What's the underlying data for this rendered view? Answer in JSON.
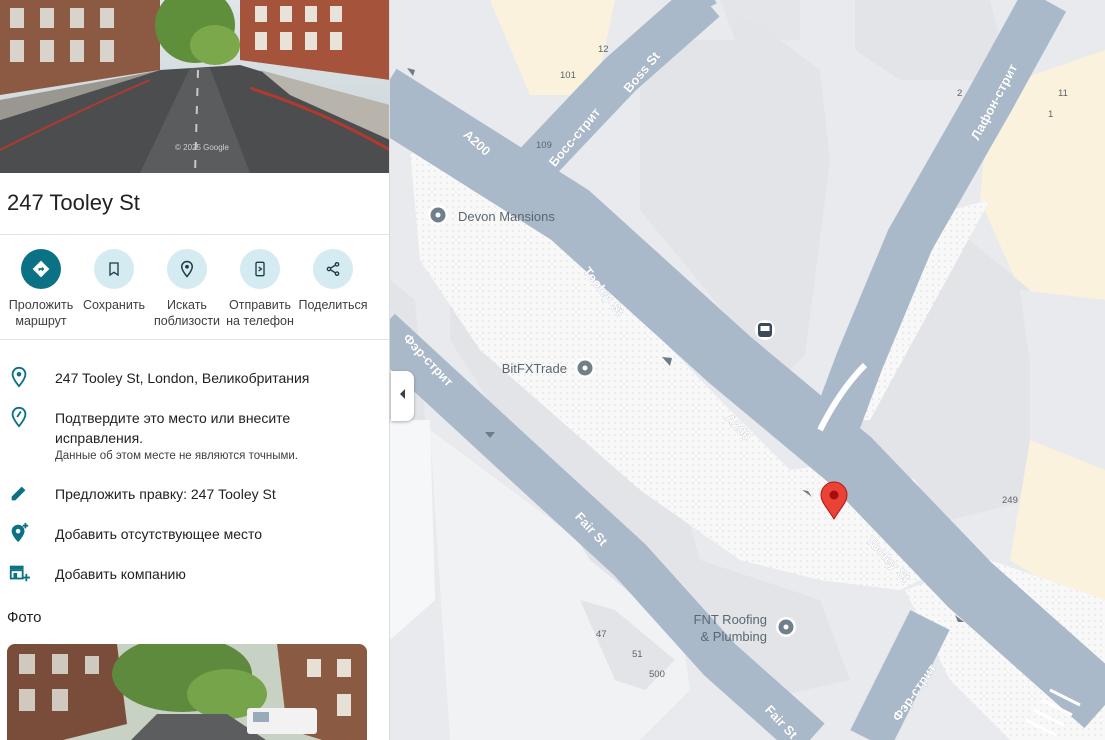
{
  "place": {
    "title": "247 Tooley St"
  },
  "street_view": {
    "watermark": "© 2025 Google"
  },
  "actions": [
    {
      "icon": "directions-icon",
      "label_line1": "Проложить",
      "label_line2": "маршрут"
    },
    {
      "icon": "bookmark-icon",
      "label_line1": "Сохранить",
      "label_line2": ""
    },
    {
      "icon": "nearby-icon",
      "label_line1": "Искать",
      "label_line2": "поблизости"
    },
    {
      "icon": "send-to-phone-icon",
      "label_line1": "Отправить",
      "label_line2": "на телефон"
    },
    {
      "icon": "share-icon",
      "label_line1": "Поделиться",
      "label_line2": ""
    }
  ],
  "info": {
    "address": "247 Tooley St, London, Великобритания",
    "confirm_line1": "Подтвердите это место или внесите",
    "confirm_line2": "исправления.",
    "confirm_sub": "Данные об этом месте не являются точными.",
    "suggest_edit": "Предложить правку: 247 Tooley St",
    "add_missing_place": "Добавить отсутствующее место",
    "add_business": "Добавить компанию"
  },
  "photos": {
    "heading": "Фото"
  },
  "map": {
    "road_labels": {
      "a200_top": "A200",
      "a200_mid": "A200",
      "tooley_st_upper": "Tooley St",
      "tooley_st_lower": "Tooley St",
      "boss_st_en": "Boss St",
      "boss_st_ru": "Босс-стрит",
      "lafone_st_ru": "Лафон-стрит",
      "fair_st_ru_upper": "Фэр-стрит",
      "fair_st_en": "Fair St",
      "fair_st_en_lower": "Fair St",
      "fair_st_ru_lower": "Фэр-стрит"
    },
    "pois": {
      "devon_mansions": "Devon Mansions",
      "bitfxtrade": "BitFXTrade",
      "fnt_line1": "FNT Roofing",
      "fnt_line2": "& Plumbing"
    },
    "building_numbers": {
      "n12": "12",
      "n101": "101",
      "n109": "109",
      "n2": "2",
      "n11": "11",
      "n1": "1",
      "n249": "249",
      "n47": "47",
      "n51": "51",
      "n500": "500"
    }
  },
  "colors": {
    "accent": "#0b7285",
    "action_bg": "#d3ebf1",
    "road": "#aab9c9",
    "pin": "#ea4335"
  }
}
